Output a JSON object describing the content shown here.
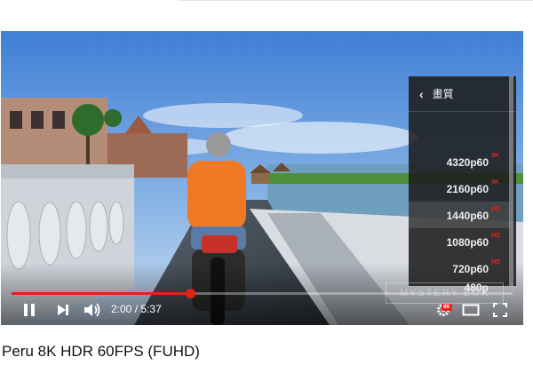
{
  "player": {
    "current_time": "2:00",
    "separator": "/",
    "duration": "5:37",
    "progress_fraction": 0.356,
    "watermark": "MYSTERY BOX",
    "settings_badge": "8K",
    "accent_color": "#e62117"
  },
  "quality_menu": {
    "header_label": "畫質",
    "items": [
      {
        "label": "4320p60",
        "badge": "8K",
        "selected": false
      },
      {
        "label": "2160p60",
        "badge": "4K",
        "selected": false
      },
      {
        "label": "1440p60",
        "badge": "HD",
        "selected": true
      },
      {
        "label": "1080p60",
        "badge": "HD",
        "selected": false
      },
      {
        "label": "720p60",
        "badge": "HD",
        "selected": false
      },
      {
        "label": "480p",
        "badge": "",
        "selected": false
      }
    ]
  },
  "icons": {
    "pause": "pause-icon",
    "next": "next-icon",
    "volume": "volume-icon",
    "settings": "gear-icon",
    "theater": "theater-mode-icon",
    "fullscreen": "fullscreen-icon",
    "back": "chevron-left-icon"
  },
  "video": {
    "title": "Peru 8K HDR 60FPS (FUHD)"
  }
}
